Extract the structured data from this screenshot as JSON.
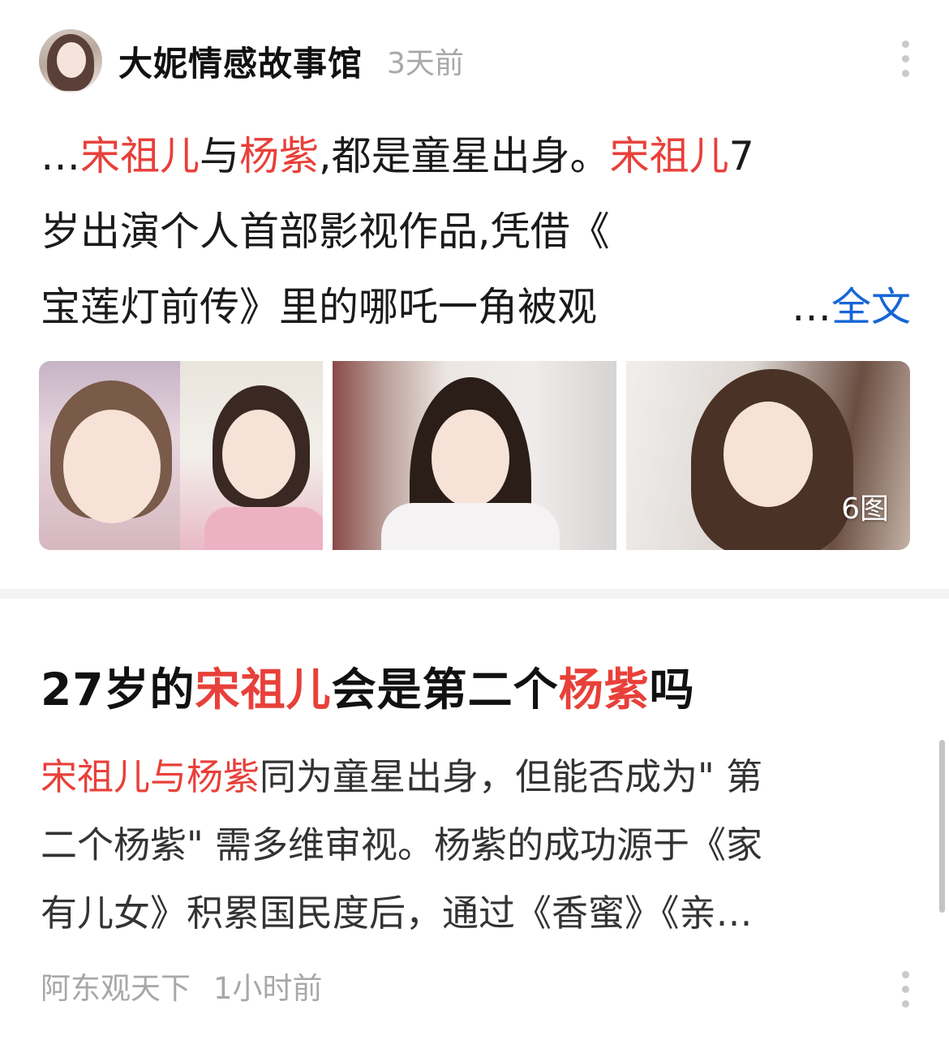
{
  "card1": {
    "author": "大妮情感故事馆",
    "time": "3天前",
    "excerpt": {
      "line1": [
        {
          "text": "…",
          "hl": false
        },
        {
          "text": "宋祖儿",
          "hl": true
        },
        {
          "text": "与",
          "hl": false
        },
        {
          "text": "杨紫",
          "hl": true
        },
        {
          "text": ",都是童星出身。",
          "hl": false
        },
        {
          "text": "宋祖儿",
          "hl": true
        },
        {
          "text": "7",
          "hl": false
        }
      ],
      "line2": "岁出演个人首部影视作品,凭借《",
      "line3": "宝莲灯前传》里的哪吒一角被观",
      "ellipsis": "…",
      "full_link": "全文"
    },
    "image_count": "6图"
  },
  "card2": {
    "title": [
      {
        "text": "27岁的",
        "hl": false
      },
      {
        "text": "宋祖儿",
        "hl": true
      },
      {
        "text": "会是第二个",
        "hl": false
      },
      {
        "text": "杨紫",
        "hl": true
      },
      {
        "text": "吗",
        "hl": false
      }
    ],
    "summary_line1": [
      {
        "text": "宋祖儿与杨紫",
        "hl": true
      },
      {
        "text": "同为童星出身，但能否成为\" 第",
        "hl": false
      }
    ],
    "summary_line2": "二个杨紫\" 需多维审视。杨紫的成功源于《家",
    "summary_line3": "有儿女》积累国民度后，通过《香蜜》《亲…",
    "source": "阿东观天下",
    "time": "1小时前"
  },
  "colors": {
    "highlight": "#e8403a",
    "link": "#1666d6",
    "meta": "#a8a8a8"
  },
  "icons": [
    "more-vertical-icon"
  ]
}
